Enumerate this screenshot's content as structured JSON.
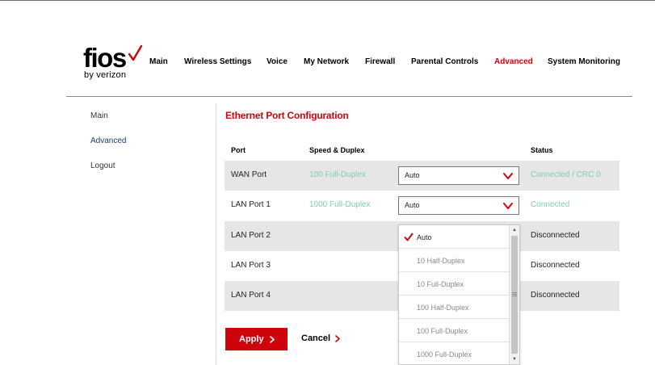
{
  "brand": {
    "logo_text": "fios",
    "logo_sub": "by verizon",
    "accent_color": "#cd040b"
  },
  "nav": {
    "items": [
      {
        "label": "Main"
      },
      {
        "label": "Wireless Settings"
      },
      {
        "label": "Voice"
      },
      {
        "label": "My Network"
      },
      {
        "label": "Firewall"
      },
      {
        "label": "Parental Controls"
      },
      {
        "label": "Advanced",
        "active": true
      },
      {
        "label": "System Monitoring"
      }
    ]
  },
  "sidebar": {
    "items": [
      {
        "label": "Main"
      },
      {
        "label": "Advanced",
        "active": true
      },
      {
        "label": "Logout"
      }
    ]
  },
  "page": {
    "title": "Ethernet Port Configuration"
  },
  "table": {
    "headers": {
      "port": "Port",
      "speed": "Speed & Duplex",
      "status": "Status"
    },
    "rows": [
      {
        "port": "WAN Port",
        "speed": "100 Full-Duplex",
        "select": "Auto",
        "status": "Connected / CRC 0"
      },
      {
        "port": "LAN Port 1",
        "speed": "1000 Full-Duplex",
        "select": "Auto",
        "status": "Connected"
      },
      {
        "port": "LAN Port 2",
        "speed": "",
        "select": "",
        "status": "Disconnected"
      },
      {
        "port": "LAN Port 3",
        "speed": "",
        "select": "",
        "status": "Disconnected"
      },
      {
        "port": "LAN Port 4",
        "speed": "",
        "select": "",
        "status": "Disconnected"
      }
    ]
  },
  "dropdown": {
    "selected": "Auto",
    "options": [
      {
        "label": "Auto"
      },
      {
        "label": "10 Half-Duplex"
      },
      {
        "label": "10 Full-Duplex"
      },
      {
        "label": "100 Half-Duplex"
      },
      {
        "label": "100 Full-Duplex"
      },
      {
        "label": "1000 Full-Duplex"
      }
    ]
  },
  "actions": {
    "apply_label": "Apply",
    "cancel_label": "Cancel"
  }
}
